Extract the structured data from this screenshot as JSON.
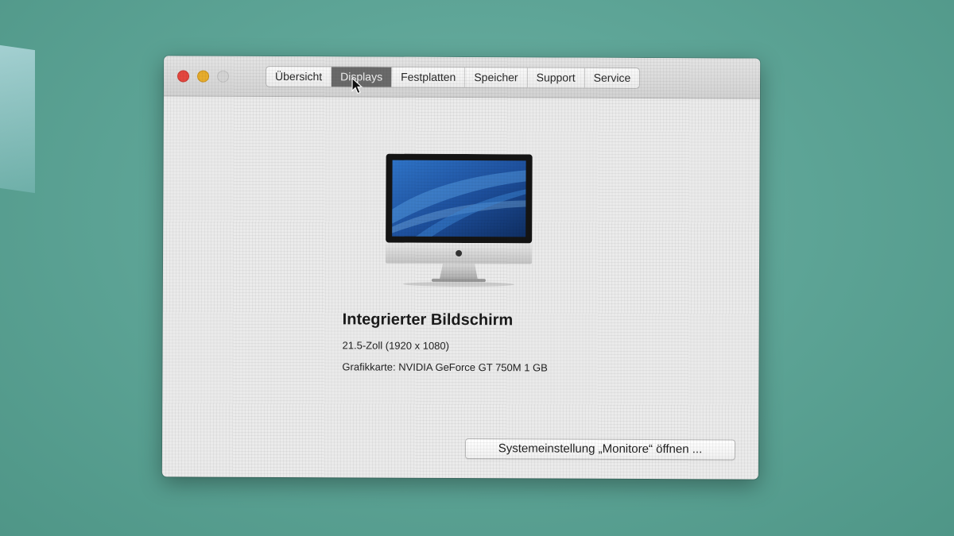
{
  "window": {
    "tabs": [
      {
        "label": "Übersicht",
        "active": false
      },
      {
        "label": "Displays",
        "active": true
      },
      {
        "label": "Festplatten",
        "active": false
      },
      {
        "label": "Speicher",
        "active": false
      },
      {
        "label": "Support",
        "active": false
      },
      {
        "label": "Service",
        "active": false
      }
    ]
  },
  "display": {
    "icon": "imac-display-icon",
    "name": "Integrierter Bildschirm",
    "size": "21.5-Zoll (1920 x 1080)",
    "gpu": "Grafikkarte: NVIDIA GeForce GT 750M 1 GB"
  },
  "actions": {
    "open_monitors_label": "Systemeinstellung „Monitore“ öffnen ..."
  },
  "colors": {
    "desktop": "#5ea597",
    "active_tab": "#6a6a6a",
    "close": "#e5473f",
    "minimize": "#e8ad2c"
  }
}
